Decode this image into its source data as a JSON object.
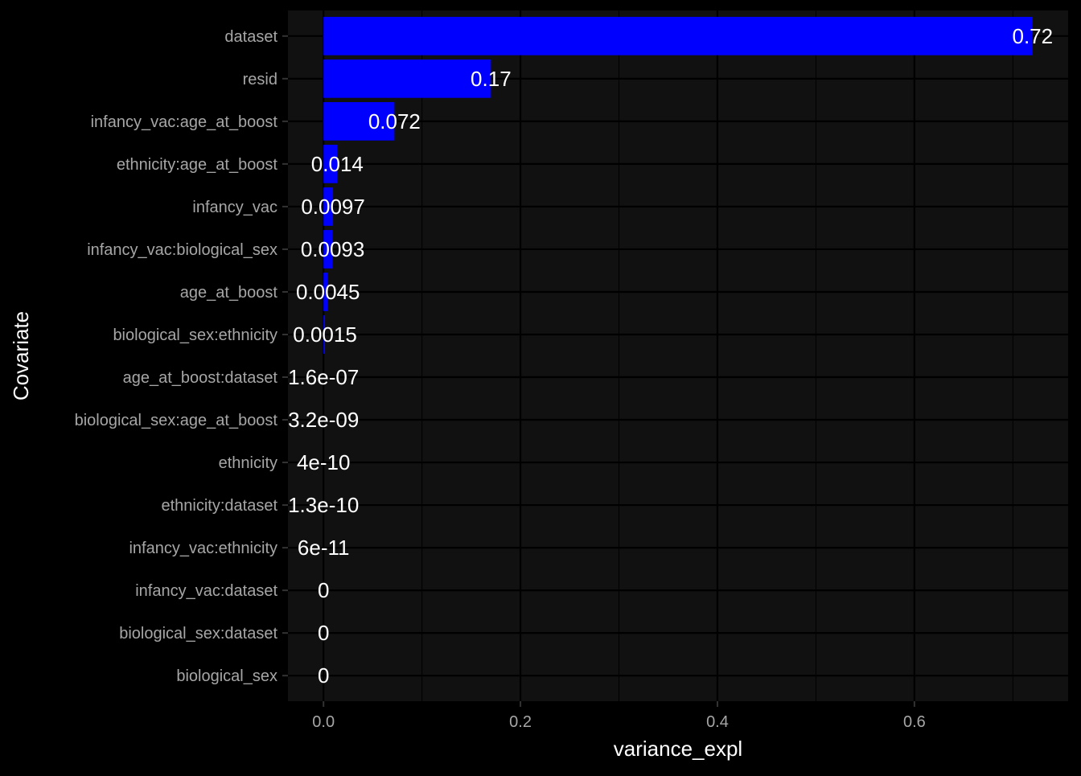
{
  "chart_data": {
    "type": "bar",
    "orientation": "horizontal",
    "title": "",
    "xlabel": "variance_expl",
    "ylabel": "Covariate",
    "xlim": [
      -0.0361,
      0.7561
    ],
    "x_ticks": [
      0.0,
      0.2,
      0.4,
      0.6
    ],
    "x_tick_labels": [
      "0.0",
      "0.2",
      "0.4",
      "0.6"
    ],
    "grid": true,
    "legend": "none",
    "bar_color": "#0000FF",
    "panel_background": "#111111",
    "background": "#000000",
    "categories": [
      "dataset",
      "resid",
      "infancy_vac:age_at_boost",
      "ethnicity:age_at_boost",
      "infancy_vac",
      "infancy_vac:biological_sex",
      "age_at_boost",
      "biological_sex:ethnicity",
      "age_at_boost:dataset",
      "biological_sex:age_at_boost",
      "ethnicity",
      "ethnicity:dataset",
      "infancy_vac:ethnicity",
      "infancy_vac:dataset",
      "biological_sex:dataset",
      "biological_sex"
    ],
    "values": [
      0.72,
      0.17,
      0.072,
      0.014,
      0.0097,
      0.0093,
      0.0045,
      0.0015,
      1.6e-07,
      3.2e-09,
      4e-10,
      1.3e-10,
      6e-11,
      0,
      0,
      0
    ],
    "data_labels": [
      "0.72",
      "0.17",
      "0.072",
      "0.014",
      "0.0097",
      "0.0093",
      "0.0045",
      "0.0015",
      "1.6e-07",
      "3.2e-09",
      "4e-10",
      "1.3e-10",
      "6e-11",
      "0",
      "0",
      "0"
    ]
  }
}
